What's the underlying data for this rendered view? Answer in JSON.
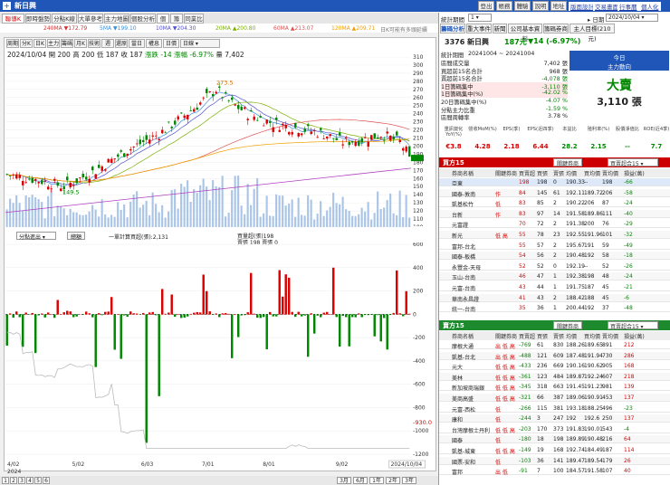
{
  "app": {
    "title": "新日興",
    "top_buttons": [
      "登出",
      "帳務",
      "體驗",
      "說明",
      "地址"
    ],
    "top_links": [
      "版面設計",
      "交易畫面",
      "行事曆",
      "個人化"
    ]
  },
  "left_tabs": [
    "聯導K線",
    "即時盤勢",
    "分點K線",
    "大單參考",
    "主力地圖",
    "個股分析",
    "個股",
    "籌碼",
    "同業比"
  ],
  "dash_text": "240MA ▼172.79",
  "ma_legend": [
    {
      "t": "5MA ▼199.10",
      "c": "#3a8fd9"
    },
    {
      "t": "10MA ▼204.30",
      "c": "#5050d0"
    },
    {
      "t": "20MA ▲200.80",
      "c": "#7ab000"
    },
    {
      "t": "60MA ▲213.07",
      "c": "#e05050"
    },
    {
      "t": "120MA ▲209.71",
      "c": "#f0a000"
    }
  ],
  "mini_legend": "日K可能有多頭延續",
  "chart_tabs": [
    "周期",
    "分K",
    "日K",
    "主力",
    "籌碼",
    "月K",
    "技術",
    "週",
    "還原",
    "當日",
    "權息",
    "日價"
  ],
  "chart_select": "日線",
  "info": {
    "date": "2024/10/04",
    "open": "開 200",
    "high": "高 200",
    "low": "低 187",
    "close": "收 187",
    "change_label": "漲跌 -14",
    "pct_label": "漲幅 -6.97%",
    "vol": "量 7,402"
  },
  "price_axis": [
    "310",
    "300",
    "290",
    "280",
    "270",
    "260",
    "250",
    "240",
    "230",
    "220",
    "210",
    "200",
    "190",
    "180",
    "170",
    "160",
    "150",
    "140",
    "130",
    "120",
    "110",
    "100"
  ],
  "peak_label": "273.5",
  "low_label": "149.5",
  "sub_select": "分點進出",
  "sub_btn": "總額",
  "sub_info1": "一單計算買超(張):2,131",
  "sub_info2": "買量超(張)198",
  "sub_info3": "賣張 198 賣張 0",
  "sub_axis": [
    "600",
    "400",
    "200",
    "0",
    "-200",
    "-400",
    "-600",
    "-800",
    "-1000",
    "-1200"
  ],
  "cum_label": "-930.0",
  "x_labels": [
    "4/02",
    "5/02",
    "6/03",
    "7/01",
    "8/01",
    "9/02",
    "2024/10/04"
  ],
  "x_year": "2024",
  "pages": [
    "1",
    "2",
    "3",
    "4",
    "5",
    "6"
  ],
  "ranges": [
    "3月",
    "6月",
    "1年",
    "2年",
    "3年"
  ],
  "chart_data": {
    "type": "candlestick",
    "x_range": [
      "2024/04/02",
      "2024/10/04"
    ],
    "price_ylim": [
      100,
      310
    ],
    "ma_values": {
      "5MA": 199.1,
      "10MA": 204.3,
      "20MA": 200.8,
      "60MA": 213.07,
      "120MA": 209.71,
      "240MA": 172.79
    },
    "high": 273.5,
    "low": 149.5,
    "last": {
      "open": 200,
      "high": 200,
      "low": 187,
      "close": 187,
      "change": -14,
      "pct": -6.97,
      "volume": 7402
    },
    "broker_net_ylim": [
      -1200,
      600
    ],
    "cumulative_last": -930.0
  },
  "right": {
    "select": "1",
    "date_label": "日期",
    "date": "2024/10/04",
    "tabs": [
      "籌碼分析",
      "重大事件",
      "新聞",
      "公司基本資料",
      "籌碼券商",
      "主人目標(210元)"
    ],
    "stock": "3376 新日興",
    "price": "187元",
    "chg": "▼14 (-6.97%)",
    "period_label": "統計期間",
    "period": "20241004 ~ 20241004",
    "stats": [
      {
        "k": "區間成交量",
        "v": "7,402 張"
      },
      {
        "k": "買超前15名合計",
        "v": "968 張"
      },
      {
        "k": "賣超前15名合計",
        "v": "-4,078 張"
      },
      {
        "k": "1日籌碼集中",
        "v": "-3,110 張"
      },
      {
        "k": "1日籌碼集中(%)",
        "v": "-42.02 %"
      },
      {
        "k": "20日籌碼集中(%)",
        "v": "-4.07 %"
      },
      {
        "k": "分點主力比重",
        "v": "-1.59 %"
      },
      {
        "k": "區間周轉率",
        "v": "3.78 %"
      }
    ],
    "box": {
      "a": "今日",
      "b": "主力動向",
      "c": "大賣",
      "d": "3,110 張"
    },
    "metrics_head": [
      "重訊變化YoY(%)",
      "營收MoM(%)",
      "EPS(季)",
      "EPS(近四季)",
      "本益比",
      "殖利率(%)",
      "股價淨值比",
      "ROE(近4季)"
    ],
    "metrics_val": [
      "€3.8",
      "4.28",
      "2.18",
      "6.44",
      "28.2",
      "2.15",
      "--",
      "7.7"
    ],
    "buy": {
      "title": "買方15",
      "btn": "關鍵券商",
      "sel": "買賣超合15",
      "cols": [
        "券商名稱",
        "關鍵券商",
        "買賣超",
        "買張",
        "賣張",
        "均價",
        "買均價",
        "賣均價",
        "損益(萬)"
      ],
      "rows": [
        [
          "亞東",
          "",
          "198",
          "198",
          "0",
          "190.33",
          "--",
          "198",
          "-66"
        ],
        [
          "國泰-敦南",
          "作",
          "84",
          "145",
          "61",
          "192.11",
          "189.72",
          "206",
          "-58"
        ],
        [
          "凱基松竹",
          "低",
          "83",
          "85",
          "2",
          "190.22",
          "206",
          "87",
          "-24"
        ],
        [
          "台新",
          "作",
          "83",
          "97",
          "14",
          "191.58",
          "189.86",
          "111",
          "-40"
        ],
        [
          "元富證",
          "",
          "70",
          "72",
          "2",
          "191.38",
          "200",
          "76",
          "-29"
        ],
        [
          "新光",
          "低 高",
          "55",
          "78",
          "23",
          "192.55",
          "191.96",
          "101",
          "-32"
        ],
        [
          "富邦-台北",
          "",
          "55",
          "57",
          "2",
          "195.67",
          "191",
          "59",
          "-49"
        ],
        [
          "國泰-板橋",
          "",
          "54",
          "56",
          "2",
          "190.48",
          "192",
          "58",
          "-18"
        ],
        [
          "永豐金-天母",
          "",
          "52",
          "52",
          "0",
          "192.19",
          "--",
          "52",
          "-26"
        ],
        [
          "玉山-台南",
          "",
          "46",
          "47",
          "1",
          "192.38",
          "198",
          "48",
          "-24"
        ],
        [
          "元富-台南",
          "",
          "43",
          "44",
          "1",
          "191.75",
          "187",
          "45",
          "-21"
        ],
        [
          "華南永昌證",
          "",
          "41",
          "43",
          "2",
          "188.42",
          "188",
          "45",
          "-6"
        ],
        [
          "統一-台南",
          "",
          "35",
          "36",
          "1",
          "200.44",
          "192",
          "37",
          "-48"
        ]
      ]
    },
    "sell": {
      "title": "賣方15",
      "btn": "關鍵券商",
      "sel": "買賣超合15",
      "cols": [
        "券商名稱",
        "關鍵券商",
        "買賣超",
        "買張",
        "賣張",
        "均價",
        "買均價",
        "賣均價",
        "損益(萬)"
      ],
      "rows": [
        [
          "摩根大通",
          "出 低 高",
          "-769",
          "61",
          "830",
          "188.26",
          "189.65",
          "891",
          "212"
        ],
        [
          "凱基-台北",
          "出 低 高",
          "-488",
          "121",
          "609",
          "187.48",
          "191.94",
          "730",
          "286"
        ],
        [
          "元大",
          "低 低 高",
          "-433",
          "236",
          "669",
          "190.16",
          "190.62",
          "905",
          "168"
        ],
        [
          "美林",
          "低 低 高",
          "-361",
          "123",
          "484",
          "189.87",
          "192.24",
          "607",
          "218"
        ],
        [
          "新加坡商瑞銀",
          "低 低 高",
          "-345",
          "318",
          "663",
          "191.45",
          "191.23",
          "981",
          "139"
        ],
        [
          "美商高盛",
          "低 低 高",
          "-321",
          "66",
          "387",
          "189.06",
          "190.91",
          "453",
          "137"
        ],
        [
          "元富-西松",
          "低",
          "-266",
          "115",
          "381",
          "193.18",
          "188.25",
          "496",
          "-23"
        ],
        [
          "康和",
          "低",
          "-244",
          "3",
          "247",
          "192",
          "192.6",
          "250",
          "137"
        ],
        [
          "台灣摩根士丹利",
          "低 低 高",
          "-203",
          "170",
          "373",
          "191.83",
          "190.01",
          "543",
          "-4"
        ],
        [
          "國泰",
          "低",
          "-180",
          "18",
          "198",
          "189.89",
          "190.48",
          "216",
          "64"
        ],
        [
          "凱基-城東",
          "低 低 高",
          "-149",
          "19",
          "168",
          "192.74",
          "184.49",
          "187",
          "114"
        ],
        [
          "國票-安和",
          "低",
          "-103",
          "36",
          "141",
          "189.47",
          "189.54",
          "179",
          "26"
        ],
        [
          "富邦",
          "出 低",
          "-91",
          "7",
          "100",
          "184.57",
          "191.58",
          "107",
          "40"
        ]
      ]
    }
  }
}
